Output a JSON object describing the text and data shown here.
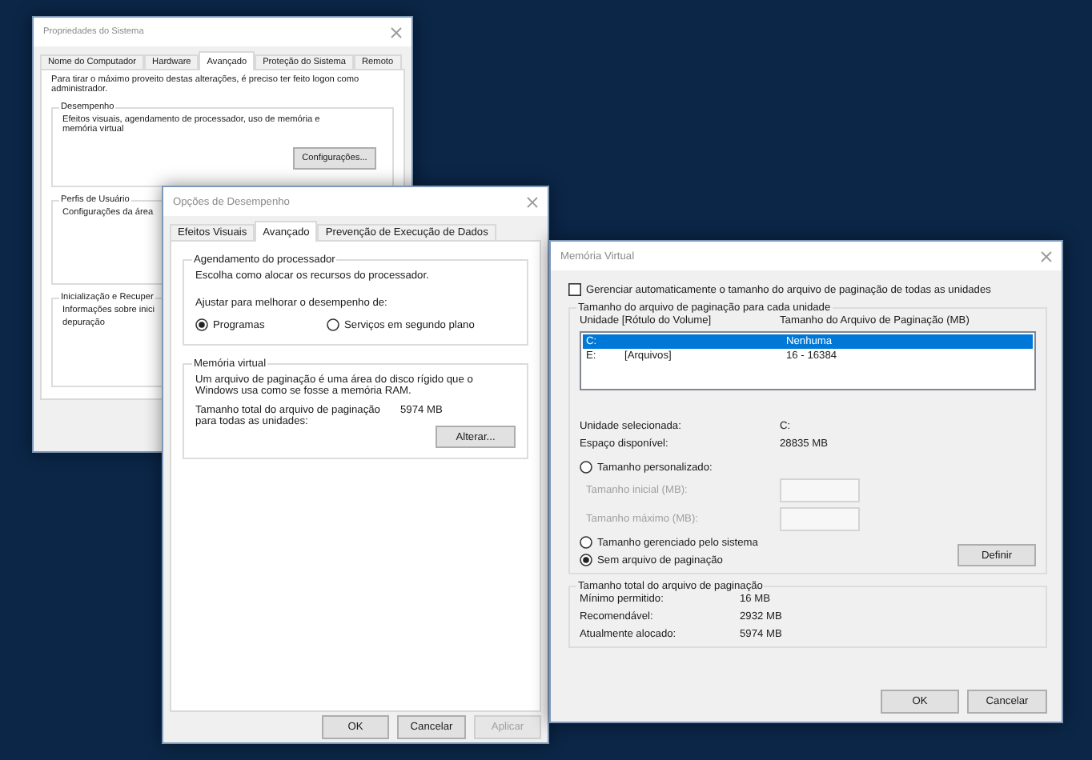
{
  "windows": [
    {
      "kind": "system_properties",
      "title": "Propriedades do Sistema",
      "tabs": [
        {
          "label": "Nome do Computador",
          "selected": false
        },
        {
          "label": "Hardware",
          "selected": false
        },
        {
          "label": "Avançado",
          "selected": true
        },
        {
          "label": "Proteção do Sistema",
          "selected": false
        },
        {
          "label": "Remoto",
          "selected": false
        }
      ],
      "intro": "Para tirar o máximo proveito destas alterações, é preciso ter feito logon como administrador.",
      "groups": [
        {
          "title": "Desempenho",
          "lines": [
            "Efeitos visuais, agendamento de processador, uso de memória e memória virtual"
          ],
          "button": "Configurações..."
        },
        {
          "title": "Perfis de Usuário",
          "lines": [
            "Configurações da área"
          ]
        },
        {
          "title": "Inicialização e Recuper",
          "lines": [
            "Informações sobre inici",
            "depuração"
          ]
        }
      ]
    },
    {
      "kind": "performance_options",
      "title": "Opções de Desempenho",
      "tabs": [
        {
          "label": "Efeitos Visuais",
          "selected": false
        },
        {
          "label": "Avançado",
          "selected": true
        },
        {
          "label": "Prevenção de Execução de Dados",
          "selected": false
        }
      ],
      "scheduling": {
        "title": "Agendamento do processador",
        "text": "Escolha como alocar os recursos do processador.",
        "prompt": "Ajustar para melhorar o desempenho de:",
        "options": [
          {
            "label": "Programas",
            "selected": true
          },
          {
            "label": "Serviços em segundo plano",
            "selected": false
          }
        ]
      },
      "virtual_memory": {
        "title": "Memória virtual",
        "text": "Um arquivo de paginação é uma área do disco rígido que o Windows usa como se fosse a memória RAM.",
        "total_label": "Tamanho total do arquivo de paginação para todas as unidades:",
        "total_value": "5974 MB",
        "button": "Alterar..."
      },
      "buttons": [
        {
          "label": "OK",
          "disabled": false
        },
        {
          "label": "Cancelar",
          "disabled": false
        },
        {
          "label": "Aplicar",
          "disabled": true
        }
      ]
    },
    {
      "kind": "virtual_memory",
      "title": "Memória Virtual",
      "auto_manage": {
        "label": "Gerenciar automaticamente o tamanho do arquivo de paginação de todas as unidades",
        "checked": false
      },
      "drives_group": {
        "title": "Tamanho do arquivo de paginação para cada unidade",
        "columns": [
          "Unidade [Rótulo do Volume]",
          "Tamanho do Arquivo de Paginação (MB)"
        ],
        "rows": [
          {
            "drive": "C:",
            "size": "Nenhuma",
            "selected": true
          },
          {
            "drive": "E:",
            "volume": "[Arquivos]",
            "size": "16 - 16384",
            "selected": false
          }
        ],
        "info": [
          {
            "label": "Unidade selecionada:",
            "value": "C:"
          },
          {
            "label": "Espaço disponível:",
            "value": "28835 MB"
          }
        ],
        "options": [
          {
            "kind": "radio",
            "label": "Tamanho personalizado:",
            "selected": false
          },
          {
            "kind": "field",
            "label": "Tamanho inicial (MB):",
            "disabled": true
          },
          {
            "kind": "field",
            "label": "Tamanho máximo (MB):",
            "disabled": true
          },
          {
            "kind": "radio",
            "label": "Tamanho gerenciado pelo sistema",
            "selected": false
          },
          {
            "kind": "radio",
            "label": "Sem arquivo de paginação",
            "selected": true
          }
        ],
        "button": "Definir"
      },
      "totals_group": {
        "title": "Tamanho total do arquivo de paginação",
        "rows": [
          {
            "label": "Mínimo permitido:",
            "value": "16 MB"
          },
          {
            "label": "Recomendável:",
            "value": "2932 MB"
          },
          {
            "label": "Atualmente alocado:",
            "value": "5974 MB"
          }
        ]
      },
      "buttons": [
        {
          "label": "OK",
          "disabled": false
        },
        {
          "label": "Cancelar",
          "disabled": false
        }
      ]
    }
  ]
}
